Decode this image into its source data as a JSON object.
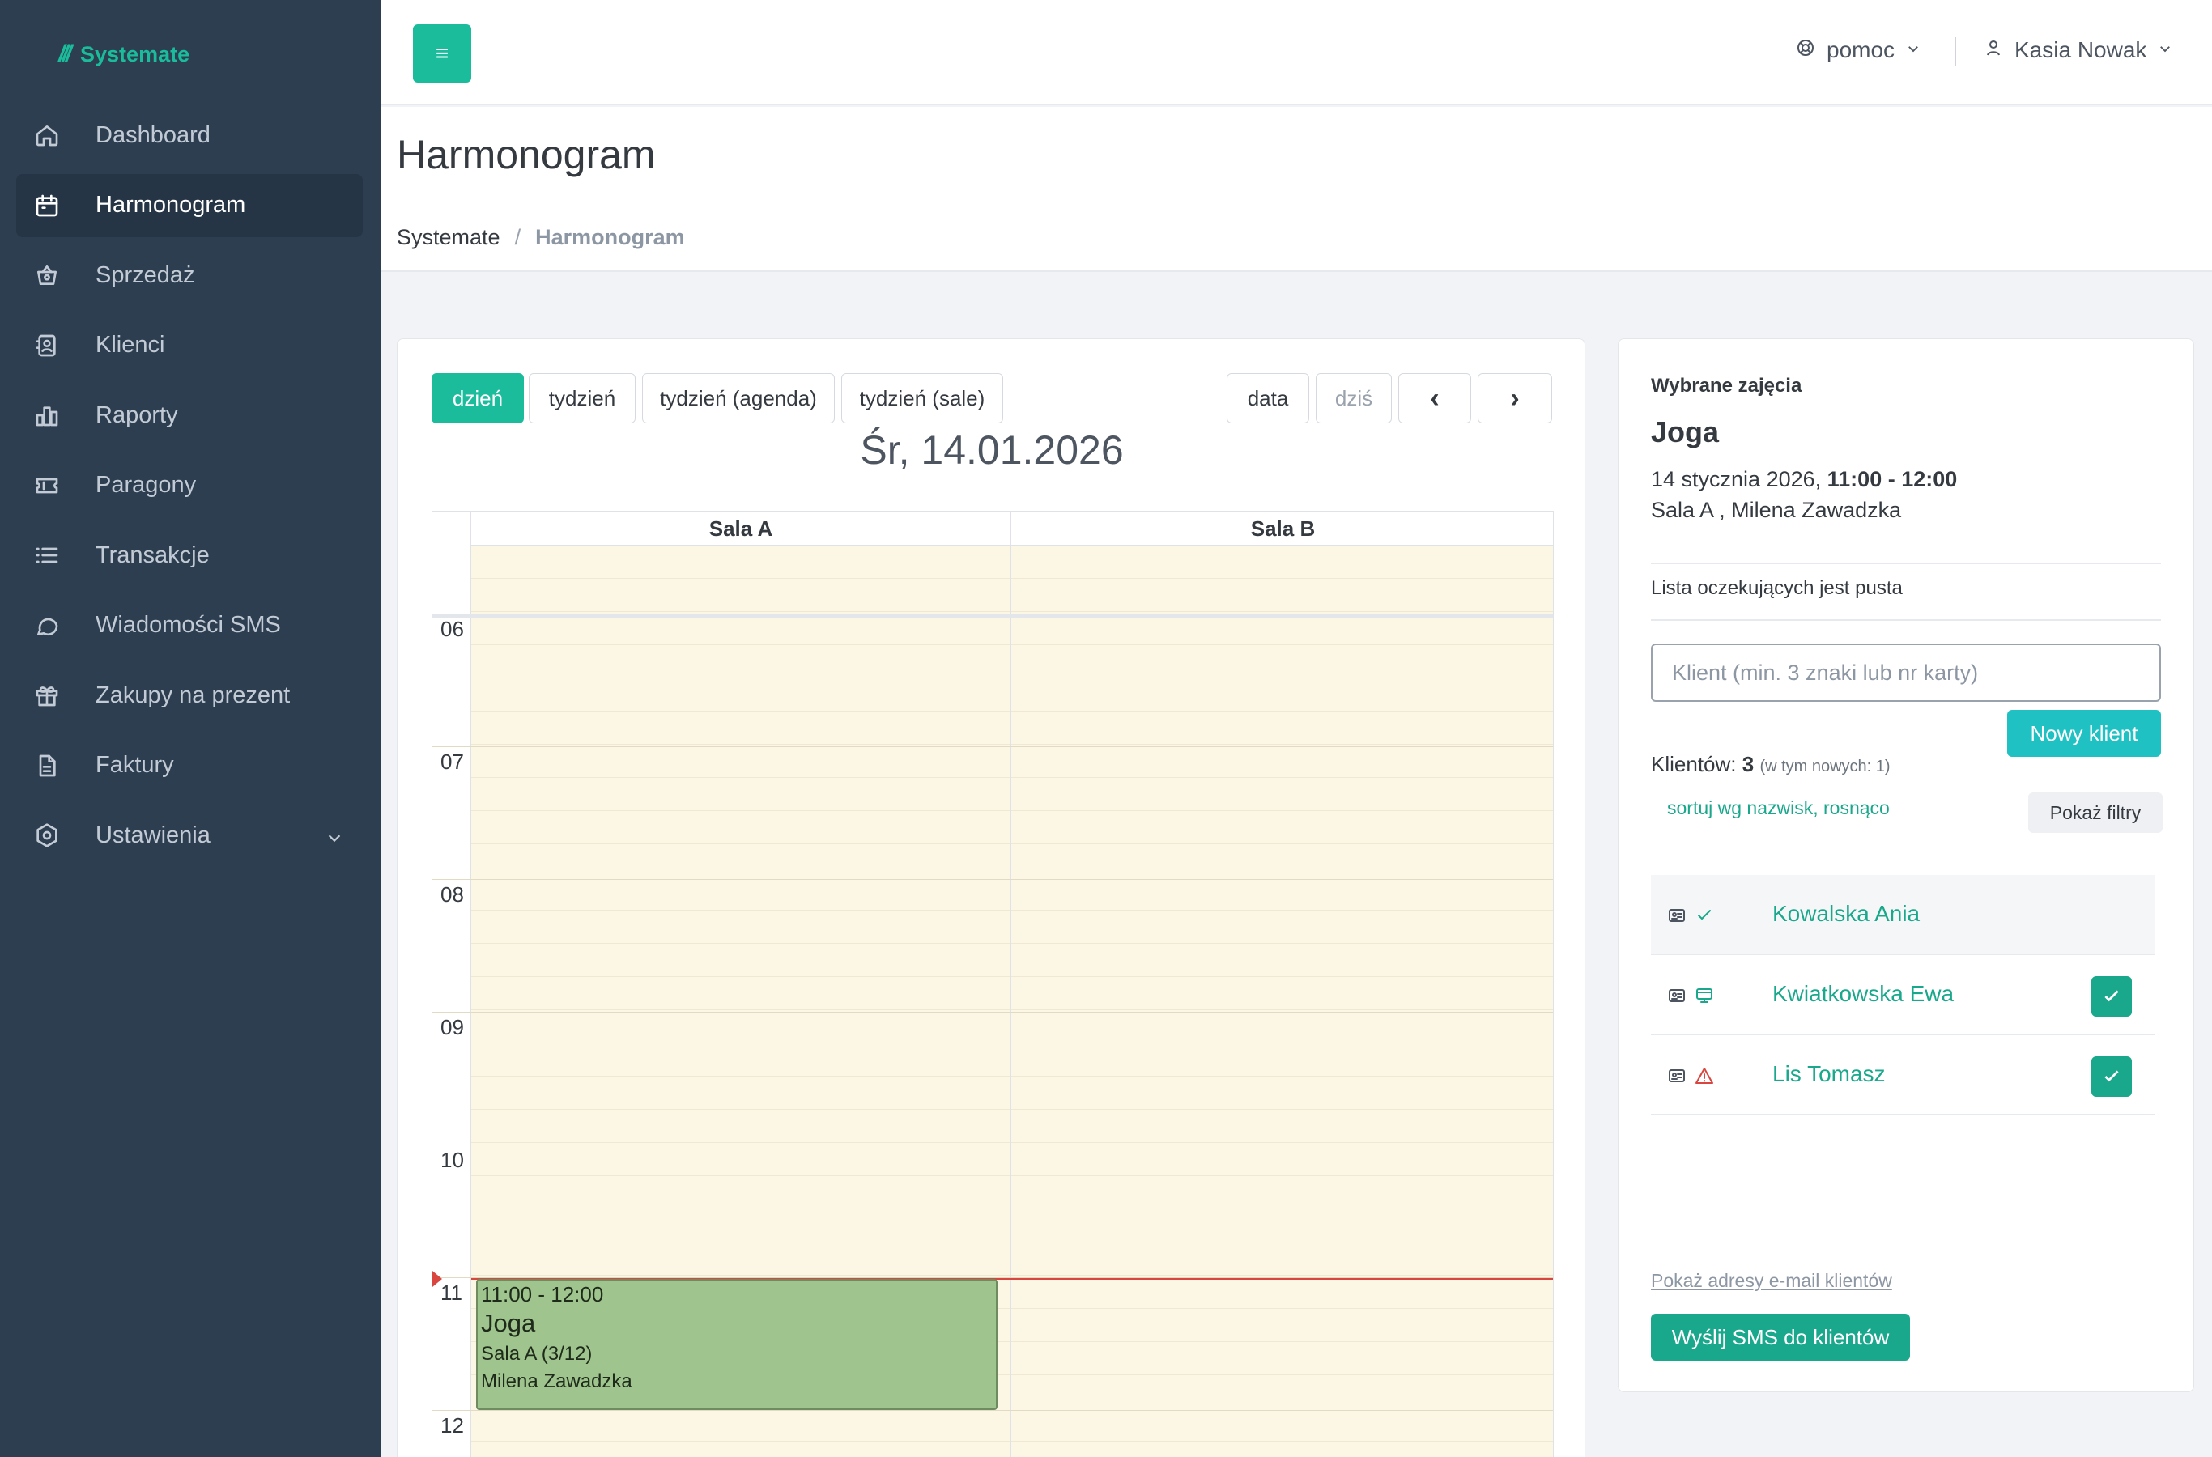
{
  "brand": {
    "name": "Systemate"
  },
  "sidebar": {
    "items": [
      {
        "label": "Dashboard",
        "icon": "home-icon"
      },
      {
        "label": "Harmonogram",
        "icon": "calendar-icon",
        "active": true
      },
      {
        "label": "Sprzedaż",
        "icon": "basket-icon"
      },
      {
        "label": "Klienci",
        "icon": "clients-icon"
      },
      {
        "label": "Raporty",
        "icon": "chart-icon"
      },
      {
        "label": "Paragony",
        "icon": "ticket-icon"
      },
      {
        "label": "Transakcje",
        "icon": "list-icon"
      },
      {
        "label": "Wiadomości SMS",
        "icon": "chat-icon"
      },
      {
        "label": "Zakupy na prezent",
        "icon": "gift-icon"
      },
      {
        "label": "Faktury",
        "icon": "invoice-icon"
      },
      {
        "label": "Ustawienia",
        "icon": "settings-icon",
        "has_submenu": true
      }
    ]
  },
  "topbar": {
    "menu_icon": "≡",
    "help_label": "pomoc",
    "user_name": "Kasia Nowak"
  },
  "page": {
    "title": "Harmonogram",
    "breadcrumb": {
      "root": "Systemate",
      "separator": "/",
      "current": "Harmonogram"
    }
  },
  "calendar": {
    "views": {
      "day": "dzień",
      "week": "tydzień",
      "week_agenda": "tydzień (agenda)",
      "week_rooms": "tydzień (sale)"
    },
    "active_view": "day",
    "nav": {
      "date": "data",
      "today": "dziś",
      "prev": "‹",
      "next": "›"
    },
    "date_title": "Śr, 14.01.2026",
    "rooms": [
      "Sala A",
      "Sala B"
    ],
    "hours": [
      "06",
      "07",
      "08",
      "09",
      "10",
      "11",
      "12"
    ],
    "event": {
      "time": "11:00 - 12:00",
      "name": "Joga",
      "room": "Sala A (3/12)",
      "instructor": "Milena Zawadzka",
      "color": "#9fc48e"
    }
  },
  "selected": {
    "label": "Wybrane zajęcia",
    "title": "Joga",
    "date": "14 stycznia 2026, ",
    "time": "11:00 - 12:00",
    "where": "Sala A , Milena Zawadzka",
    "waitlist": "Lista oczekujących jest pusta",
    "client_placeholder": "Klient (min. 3 znaki lub nr karty)",
    "new_client_label": "Nowy klient",
    "count_label": "Klientów: ",
    "count_value": "3",
    "count_note": "(w tym  nowych: 1)",
    "sort_label": "sortuj wg nazwisk, rosnąco",
    "filters_label": "Pokaż filtry",
    "clients": [
      {
        "name": "Kowalska Ania",
        "status_icon": "check-icon",
        "checked": false
      },
      {
        "name": "Kwiatkowska Ewa",
        "status_icon": "card-pay-icon",
        "checked": true
      },
      {
        "name": "Lis Tomasz",
        "status_icon": "warning-icon",
        "checked": true
      }
    ],
    "emails_link": "Pokaż adresy e-mail klientów",
    "sms_button": "Wyślij SMS do klientów"
  },
  "colors": {
    "accent": "#1abc9c",
    "sidebar_bg": "#2d3e50",
    "grid_bg": "#fcf7e4",
    "now_line": "#d9453f",
    "warning": "#d9453f"
  }
}
